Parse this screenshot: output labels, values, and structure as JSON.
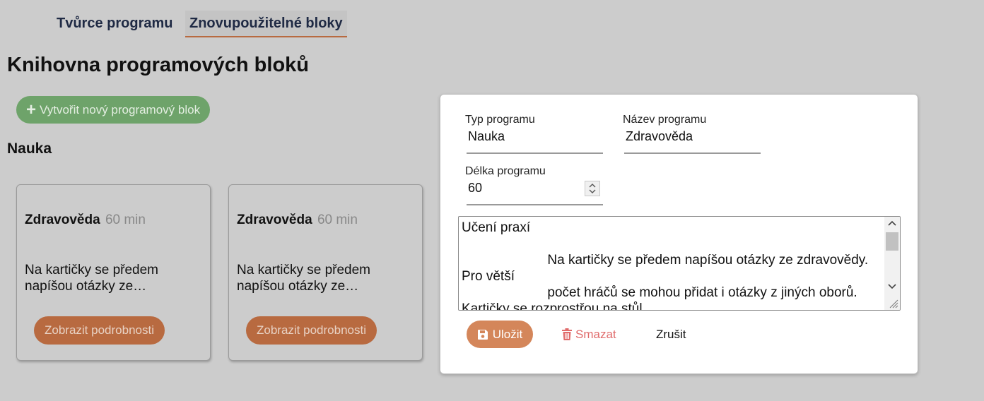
{
  "tabs": [
    {
      "label": "Tvůrce programu"
    },
    {
      "label": "Znovupoužitelné bloky",
      "active": true
    }
  ],
  "page_title": "Knihovna programových bloků",
  "create_button": {
    "label": "Vytvořit nový programový blok",
    "icon": "plus-icon"
  },
  "section": {
    "title": "Nauka"
  },
  "cards": [
    {
      "name": "Zdravověda",
      "duration": "60 min",
      "description": "Na kartičky se předem napíšou otázky ze…",
      "button": "Zobrazit podrobnosti"
    },
    {
      "name": "Zdravověda",
      "duration": "60 min",
      "description": "Na kartičky se předem napíšou otázky ze…",
      "button": "Zobrazit podrobnosti"
    }
  ],
  "edit_form": {
    "type": {
      "label": "Typ programu",
      "value": "Nauka"
    },
    "name": {
      "label": "Název programu",
      "value": "Zdravověda"
    },
    "length": {
      "label": "Délka programu",
      "value": "60"
    },
    "description": "Učení praxí\n\n                       Na kartičky se předem napíšou otázky ze zdravovědy. Pro větší\n                       počet hráčů se mohou přidat i otázky z jiných oborů. Kartičky se rozprostřou na stůl.",
    "save_label": "Uložit",
    "delete_label": "Smazat",
    "cancel_label": "Zrušit"
  },
  "colors": {
    "background": "#cccccc",
    "create_button": "#6ea36a",
    "accent": "#b86a40",
    "save_button": "#d4865a",
    "delete": "#e06b6b",
    "tab_text": "#1f2a44"
  },
  "icons": {
    "save": "floppy-disk-icon",
    "delete": "trash-icon",
    "create": "plus-icon"
  }
}
